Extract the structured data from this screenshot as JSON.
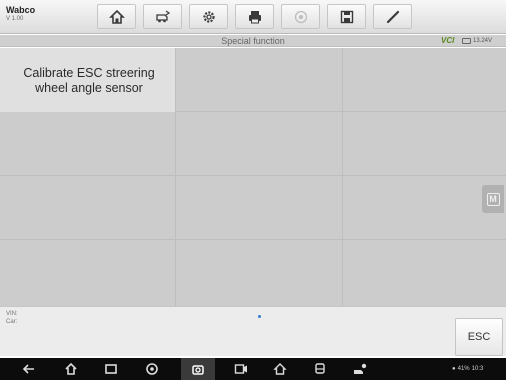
{
  "app": {
    "name": "Wabco",
    "version": "V 1.00"
  },
  "toolbar": {
    "buttons": [
      {
        "name": "home-button",
        "icon": "home-icon"
      },
      {
        "name": "vehicle-swap-button",
        "icon": "vehicle-swap-icon"
      },
      {
        "name": "settings-button",
        "icon": "gear-icon"
      },
      {
        "name": "print-button",
        "icon": "printer-icon"
      },
      {
        "name": "help-button",
        "icon": "help-icon"
      },
      {
        "name": "save-button",
        "icon": "save-icon"
      },
      {
        "name": "edit-button",
        "icon": "pen-icon"
      }
    ]
  },
  "header": {
    "title": "Special function",
    "vci_label": "VCI",
    "battery_voltage": "13.24V"
  },
  "functions": [
    {
      "label": "Calibrate ESC streering wheel angle sensor"
    }
  ],
  "info": {
    "vin_label": "VIN:",
    "car_label": "Car:"
  },
  "esc_button": {
    "label": "ESC"
  },
  "side_button": {
    "label": "M"
  },
  "status_bar": {
    "wifi": "wifi-icon",
    "battery": "41%",
    "time": "10:3"
  },
  "colors": {
    "grid_bg": "#cccccc",
    "selected_cell": "#e0e0e0",
    "vci_green": "#5b8a1e",
    "navbar": "#0c0c0c"
  }
}
